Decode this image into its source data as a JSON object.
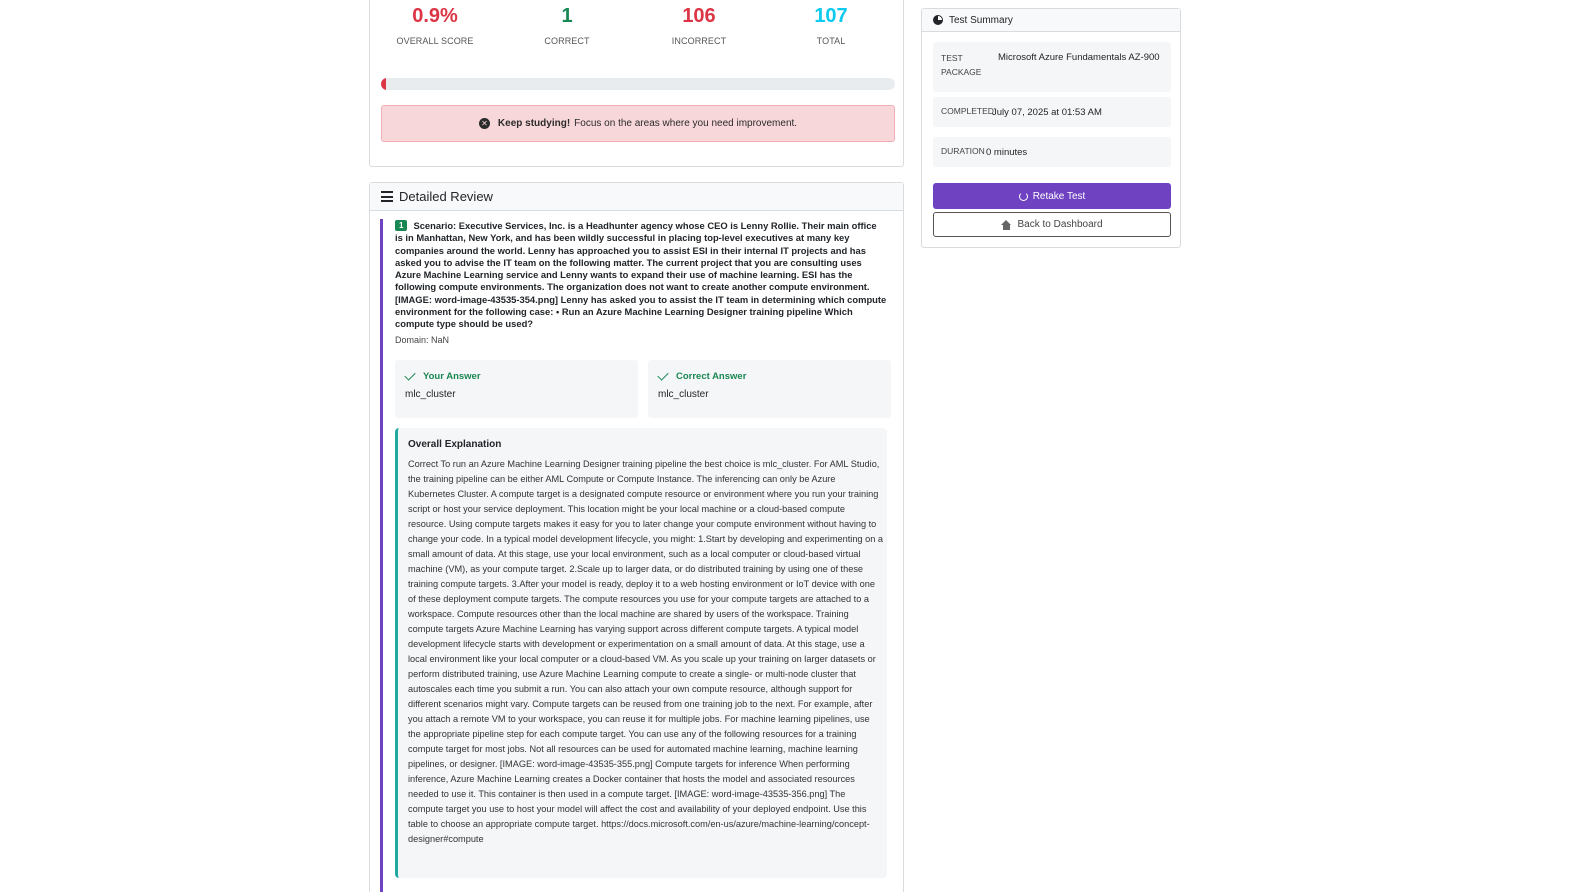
{
  "stats": {
    "overall_score": "0.9%",
    "overall_score_label": "OVERALL SCORE",
    "correct": "1",
    "correct_label": "CORRECT",
    "incorrect": "106",
    "incorrect_label": "INCORRECT",
    "total": "107",
    "total_label": "TOTAL",
    "progress_fraction": 0.009
  },
  "alert": {
    "strong": "Keep studying!",
    "text": "Focus on the areas where you need improvement."
  },
  "review": {
    "header": "Detailed Review",
    "question_number": "1",
    "question_text": "Scenario: Executive Services, Inc. is a Headhunter agency whose CEO is Lenny Rollie. Their main office is in Manhattan, New York, and has been wildly successful in placing top-level executives at many key companies around the world. Lenny has approached you to assist ESI in their internal IT projects and has asked you to advise the IT team on the following matter. The current project that you are consulting uses Azure Machine Learning service and Lenny wants to expand their use of machine learning. ESI has the following compute environments. The organization does not want to create another compute environment. [IMAGE: word-image-43535-354.png] Lenny has asked you to assist the IT team in determining which compute environment for the following case: • Run an Azure Machine Learning Designer training pipeline Which compute type should be used?",
    "domain": "Domain: NaN",
    "your_answer_label": "Your Answer",
    "your_answer": "mlc_cluster",
    "correct_answer_label": "Correct Answer",
    "correct_answer": "mlc_cluster",
    "explanation_title": "Overall Explanation",
    "explanation": "Correct To run an Azure Machine Learning Designer training pipeline the best choice is mlc_cluster. For AML Studio, the training pipeline can be either AML Compute or Compute Instance. The inferencing can only be Azure Kubernetes Cluster. A compute target is a designated compute resource or environment where you run your training script or host your service deployment. This location might be your local machine or a cloud-based compute resource. Using compute targets makes it easy for you to later change your compute environment without having to change your code. In a typical model development lifecycle, you might: 1.Start by developing and experimenting on a small amount of data. At this stage, use your local environment, such as a local computer or cloud-based virtual machine (VM), as your compute target. 2.Scale up to larger data, or do distributed training by using one of these training compute targets. 3.After your model is ready, deploy it to a web hosting environment or IoT device with one of these deployment compute targets. The compute resources you use for your compute targets are attached to a workspace. Compute resources other than the local machine are shared by users of the workspace. Training compute targets Azure Machine Learning has varying support across different compute targets. A typical model development lifecycle starts with development or experimentation on a small amount of data. At this stage, use a local environment like your local computer or a cloud-based VM. As you scale up your training on larger datasets or perform distributed training, use Azure Machine Learning compute to create a single- or multi-node cluster that autoscales each time you submit a run. You can also attach your own compute resource, although support for different scenarios might vary. Compute targets can be reused from one training job to the next. For example, after you attach a remote VM to your workspace, you can reuse it for multiple jobs. For machine learning pipelines, use the appropriate pipeline step for each compute target. You can use any of the following resources for a training compute target for most jobs. Not all resources can be used for automated machine learning, machine learning pipelines, or designer. [IMAGE: word-image-43535-355.png] Compute targets for inference When performing inference, Azure Machine Learning creates a Docker container that hosts the model and associated resources needed to use it. This container is then used in a compute target. [IMAGE: word-image-43535-356.png] The compute target you use to host your model will affect the cost and availability of your deployed endpoint. Use this table to choose an appropriate compute target. https://docs.microsoft.com/en-us/azure/machine-learning/concept-designer#compute"
  },
  "summary": {
    "header": "Test Summary",
    "package_label_1": "TEST",
    "package_label_2": "PACKAGE",
    "package_value": "Microsoft Azure Fundamentals AZ-900",
    "completed_label": "COMPLETED",
    "completed_value": "July 07, 2025 at 01:53 AM",
    "duration_label": "DURATION",
    "duration_value": "0 minutes",
    "retake_label": "Retake Test",
    "dashboard_label": "Back to Dashboard"
  },
  "colors": {
    "danger": "#dc3545",
    "success": "#198754",
    "info": "#0dcaf0",
    "primary_purple": "#6f42c1",
    "teal": "#20a9a0"
  },
  "icons": [
    "close-circle-icon",
    "list-icon",
    "check-icon",
    "pie-chart-icon",
    "redo-icon",
    "home-icon"
  ]
}
